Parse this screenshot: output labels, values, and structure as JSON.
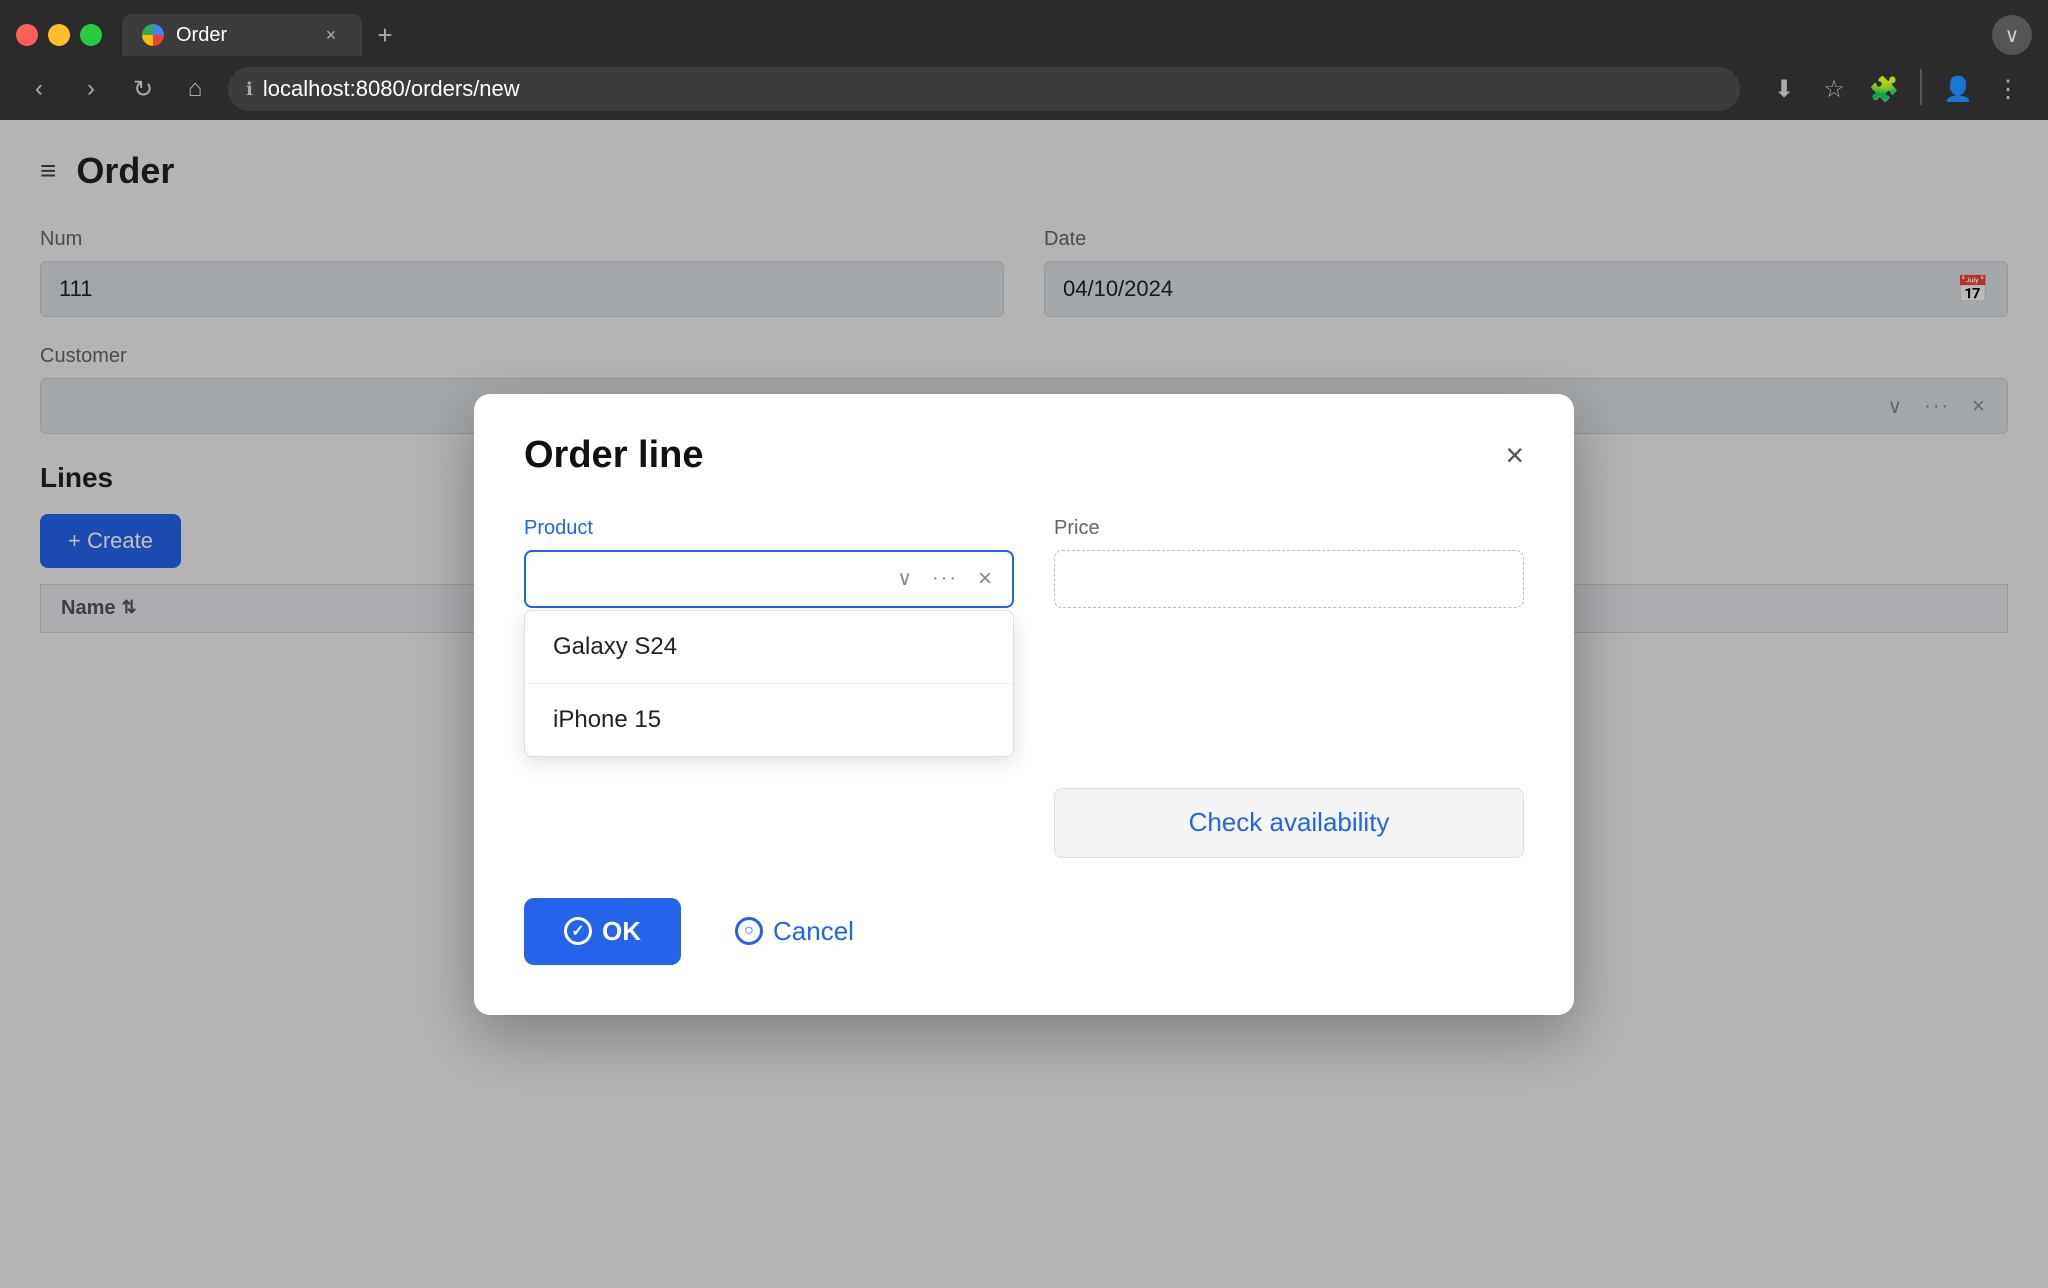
{
  "browser": {
    "url": "localhost:8080/orders/new",
    "tab_title": "Order",
    "tab_close": "×",
    "tab_new": "+",
    "nav": {
      "back": "‹",
      "forward": "›",
      "refresh": "↻",
      "home": "⌂"
    },
    "actions": {
      "download": "⬇",
      "bookmark": "☆",
      "extensions": "🧩",
      "profile": "👤",
      "menu": "⋮",
      "expand": "∨"
    }
  },
  "page": {
    "title": "Order",
    "hamburger": "≡"
  },
  "form": {
    "num_label": "Num",
    "num_value": "111",
    "date_label": "Date",
    "date_value": "04/10/2024",
    "customer_label": "Customer"
  },
  "lines": {
    "title": "Lines",
    "create_btn": "+ Create",
    "table": {
      "name_header": "Name"
    }
  },
  "modal": {
    "title": "Order line",
    "close": "×",
    "product_label": "Product",
    "product_placeholder": "",
    "price_label": "Price",
    "check_availability": "Check availability",
    "ok_label": "OK",
    "cancel_label": "Cancel",
    "dropdown_items": [
      {
        "id": 1,
        "name": "Galaxy S24"
      },
      {
        "id": 2,
        "name": "iPhone 15"
      }
    ],
    "icons": {
      "dropdown_arrow": "∨",
      "more": "···",
      "clear": "×",
      "check": "✓"
    }
  }
}
